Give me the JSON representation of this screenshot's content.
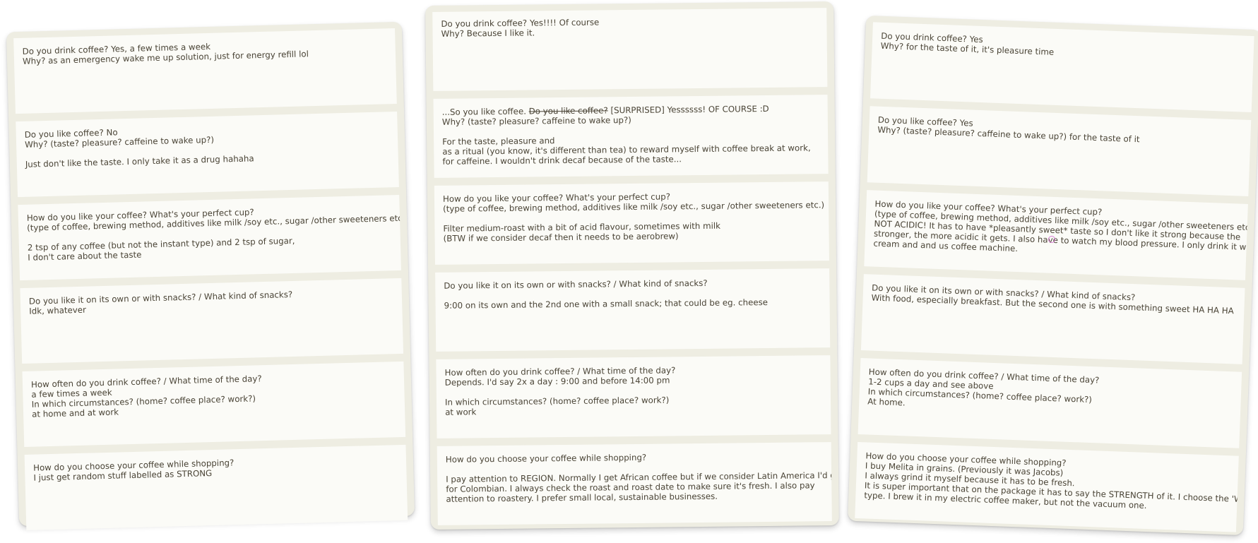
{
  "boards": {
    "left": {
      "cards": [
        {
          "lines": [
            "Do you drink coffee? Yes, a few times a week",
            "Why? as an emergency wake me up solution, just for energy refill lol"
          ]
        },
        {
          "lines": [
            "Do you like coffee? No",
            "Why? (taste? pleasure? caffeine to wake up?)",
            "",
            "Just don't like the taste. I only take it as a drug hahaha"
          ]
        },
        {
          "lines": [
            "How do you like your coffee? What's your perfect cup?",
            "(type of coffee, brewing method, additives like milk /soy etc., sugar /other sweeteners etc.)",
            "",
            "2 tsp of any coffee (but not the instant type) and 2 tsp of sugar,",
            "I don't care about the taste"
          ]
        },
        {
          "lines": [
            "Do you like it on its own or with snacks? / What kind of snacks?",
            "Idk, whatever"
          ]
        },
        {
          "lines": [
            "How often do you drink coffee? / What time of the day?",
            "a few times a week",
            "In which circumstances? (home? coffee place? work?)",
            "at home and at work"
          ]
        },
        {
          "lines": [
            "How do you choose your coffee while shopping?",
            "I just get random stuff labelled as STRONG"
          ]
        }
      ]
    },
    "middle": {
      "cards": [
        {
          "lines": [
            "Do you drink coffee? Yes!!!! Of course",
            "Why? Because I like it."
          ]
        },
        {
          "first_prefix": "...So you like coffee. ",
          "first_strike": "Do you like coffee?",
          "first_suffix": " [SURPRISED] Yessssss! OF COURSE :D",
          "lines": [
            "Why? (taste? pleasure? caffeine to wake up?)",
            "",
            "For the taste, pleasure and",
            "as a ritual (you know, it's different than tea) to reward myself with coffee break at work,",
            "for caffeine. I wouldn't drink decaf because of the taste..."
          ]
        },
        {
          "lines": [
            "How do you like your coffee? What's your perfect cup?",
            "(type of coffee, brewing method, additives like milk /soy etc., sugar /other sweeteners etc.)",
            "",
            "Filter medium-roast with a bit of acid flavour, sometimes with milk",
            "(BTW if we consider decaf then it needs to be aerobrew)"
          ]
        },
        {
          "lines": [
            "Do you like it on its own or with snacks? / What kind of snacks?",
            "",
            "9:00 on its own and the 2nd one with a small snack; that could be eg. cheese"
          ]
        },
        {
          "lines": [
            "How often do you drink coffee? / What time of the day?",
            "Depends. I'd say 2x a day : 9:00 and before 14:00 pm",
            "",
            "In which circumstances? (home? coffee place? work?)",
            "at work"
          ]
        },
        {
          "lines": [
            "How do you choose your coffee while shopping?",
            "",
            "I pay attention to REGION. Normally I get African coffee but if we consider Latin America I'd go",
            "for Colombian. I always check the roast and roast date to make sure it's fresh. I also pay",
            "attention to roastery. I prefer small local, sustainable businesses."
          ]
        }
      ]
    },
    "right": {
      "cards": [
        {
          "lines": [
            "Do you drink coffee? Yes",
            "Why? for the taste of it, it's pleasure time"
          ]
        },
        {
          "lines": [
            "Do you like coffee? Yes",
            "Why? (taste? pleasure? caffeine to wake up?) for the taste of it"
          ]
        },
        {
          "lines": [
            "How do you like your coffee? What's your perfect cup?",
            "(type of coffee, brewing method, additives like milk /soy etc., sugar /other sweeteners etc.)",
            "NOT ACIDIC! It has to have *pleasantly sweet* taste so I don't like it strong because the",
            "stronger, the more acidic it gets. I also have to watch my blood pressure. I only drink it with",
            "cream and and us coffee machine."
          ]
        },
        {
          "lines": [
            "Do you like it on its own or with snacks? / What kind of snacks?",
            "With food, especially breakfast. But the second one is with something sweet HA HA HA"
          ]
        },
        {
          "lines": [
            "How often do you drink coffee? / What time of the day?",
            "1-2 cups a day and see above",
            "In which circumstances? (home? coffee place? work?)",
            "At home."
          ]
        },
        {
          "lines": [
            "How do you choose your coffee while shopping?",
            "I buy Melita in grains. (Previously it was Jacobs)",
            "I always grind it myself because it has to be fresh.",
            "It is super important that on the package it has to say the STRENGTH of it. I choose the 'WEAK'",
            "type. I brew it in my electric coffee maker, but not the vacuum one."
          ]
        }
      ]
    }
  }
}
